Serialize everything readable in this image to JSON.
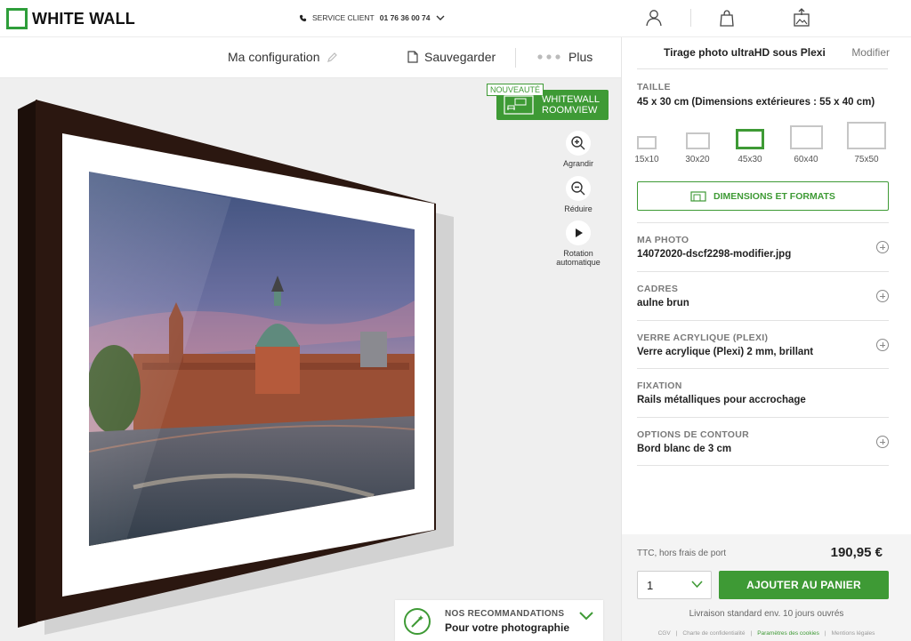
{
  "header": {
    "logo_text": "WHITE WALL",
    "service_prefix": "SERVICE CLIENT",
    "service_phone": "01 76 36 00 74"
  },
  "toolbar": {
    "config_label": "Ma configuration",
    "save_label": "Sauvegarder",
    "more_label": "Plus"
  },
  "preview": {
    "roomview_badge": "NOUVEAUTÉ",
    "roomview_line1": "WHITEWALL",
    "roomview_line2": "ROOMVIEW",
    "zoom_in_label": "Agrandir",
    "zoom_out_label": "Réduire",
    "rotate_label_1": "Rotation",
    "rotate_label_2": "automatique",
    "reco_title": "NOS RECOMMANDATIONS",
    "reco_subtitle": "Pour votre photographie"
  },
  "panel": {
    "product_name": "Tirage photo ultraHD sous Plexi",
    "modify_label": "Modifier",
    "size_label": "TAILLE",
    "size_value": "45 x 30 cm (Dimensions extérieures : 55 x 40 cm)",
    "sizes": [
      "15x10",
      "30x20",
      "45x30",
      "60x40",
      "75x50"
    ],
    "selected_size": "45x30",
    "dimensions_button": "DIMENSIONS ET FORMATS",
    "options": [
      {
        "label": "MA PHOTO",
        "value": "14072020-dscf2298-modifier.jpg",
        "expandable": true
      },
      {
        "label": "CADRES",
        "value": "aulne brun",
        "expandable": true
      },
      {
        "label": "VERRE ACRYLIQUE (PLEXI)",
        "value": "Verre acrylique (Plexi) 2 mm, brillant",
        "expandable": true
      },
      {
        "label": "FIXATION",
        "value": "Rails métalliques pour accrochage",
        "expandable": false
      },
      {
        "label": "OPTIONS DE CONTOUR",
        "value": "Bord blanc de 3 cm",
        "expandable": true
      }
    ],
    "price_note": "TTC, hors frais de port",
    "price": "190,95 €",
    "quantity": "1",
    "add_to_cart": "AJOUTER AU PANIER",
    "delivery": "Livraison standard  env. 10 jours ouvrés",
    "footer_links": [
      "CGV",
      "Charte de confidentialité",
      "Paramètres des cookies",
      "Mentions légales"
    ]
  },
  "colors": {
    "accent": "#3e9a35",
    "frame": "#2b1710",
    "background": "#efefef"
  }
}
